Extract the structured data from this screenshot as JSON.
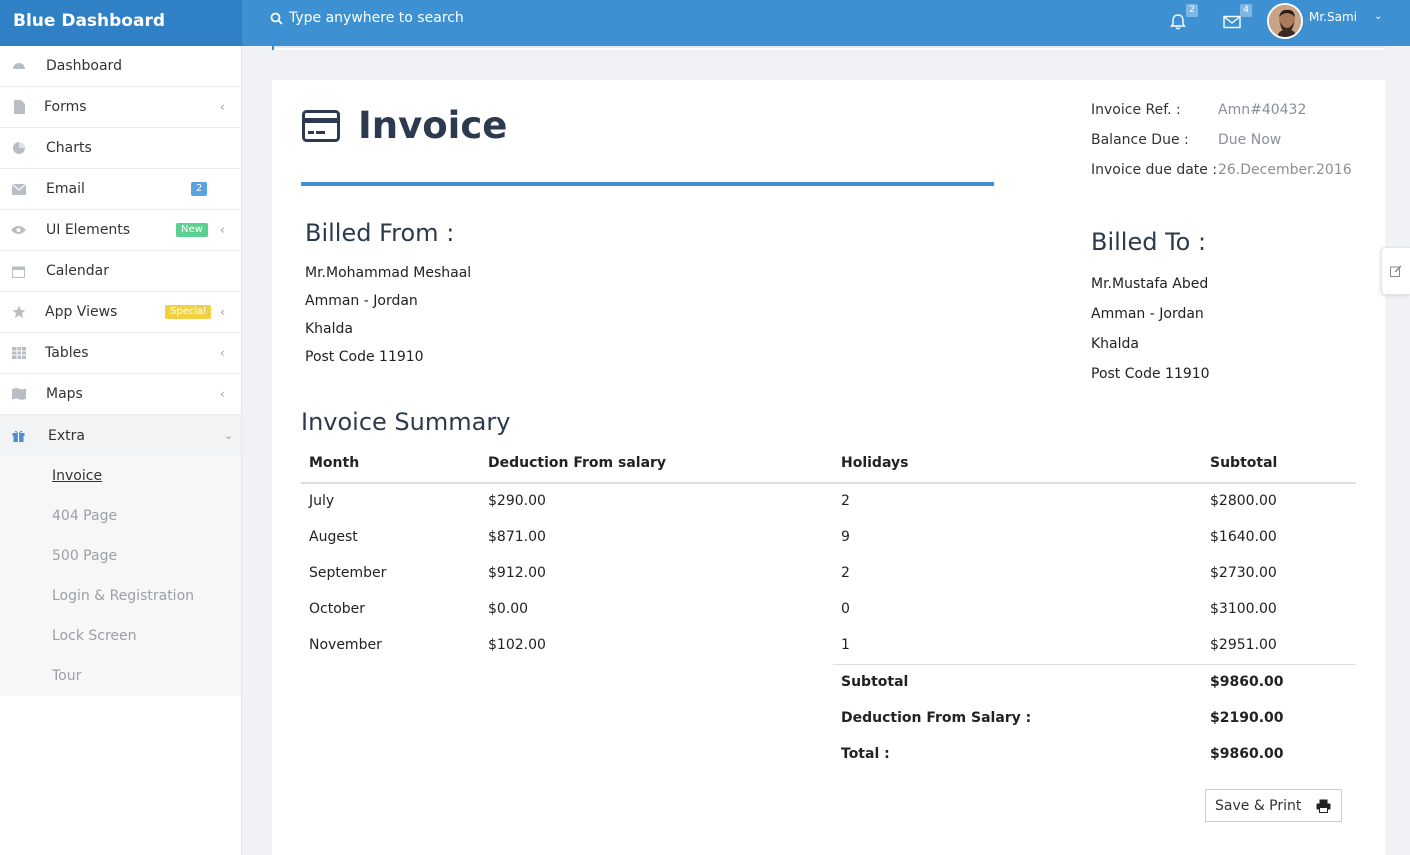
{
  "app": {
    "brand": "Blue Dashboard",
    "search_placeholder": "Type anywhere to search",
    "notifications_count": "2",
    "messages_count": "4",
    "user_name": "Mr.Sami"
  },
  "sidebar": {
    "items": [
      {
        "label": "Dashboard",
        "icon": "dashboard-icon"
      },
      {
        "label": "Forms",
        "icon": "file-icon"
      },
      {
        "label": "Charts",
        "icon": "pie-chart-icon"
      },
      {
        "label": "Email",
        "icon": "envelope-icon",
        "badge": "2"
      },
      {
        "label": "UI Elements",
        "icon": "eye-icon",
        "badge": "New"
      },
      {
        "label": "Calendar",
        "icon": "calendar-icon"
      },
      {
        "label": "App Views",
        "icon": "star-icon",
        "badge": "Special"
      },
      {
        "label": "Tables",
        "icon": "table-icon"
      },
      {
        "label": "Maps",
        "icon": "map-icon"
      },
      {
        "label": "Extra",
        "icon": "gift-icon"
      }
    ],
    "extra_sub": [
      "Invoice",
      "404 Page",
      "500 Page",
      "Login & Registration",
      "Lock Screen",
      "Tour"
    ],
    "colors": {
      "email_badge": "#5ba3dd",
      "new_badge": "#5cd18f",
      "special_badge": "#f1d13f"
    }
  },
  "invoice": {
    "title": "Invoice",
    "meta": [
      {
        "label": "Invoice Ref. :",
        "value": "Amn#40432"
      },
      {
        "label": "Balance Due :",
        "value": "Due Now"
      },
      {
        "label": "Invoice due date :",
        "value": "26.December.2016"
      }
    ],
    "billed_from": {
      "heading": "Billed From :",
      "lines": [
        "Mr.Mohammad Meshaal",
        "Amman - Jordan",
        "Khalda",
        "Post Code 11910"
      ]
    },
    "billed_to": {
      "heading": "Billed To :",
      "lines": [
        "Mr.Mustafa Abed",
        "Amman - Jordan",
        "Khalda",
        "Post Code 11910"
      ]
    },
    "summary_title": "Invoice Summary",
    "columns": [
      "Month",
      "Deduction From salary",
      "Holidays",
      "Subtotal"
    ],
    "rows": [
      [
        "July",
        "$290.00",
        "2",
        "$2800.00"
      ],
      [
        "Augest",
        "$871.00",
        "9",
        "$1640.00"
      ],
      [
        "September",
        "$912.00",
        "2",
        "$2730.00"
      ],
      [
        "October",
        "$0.00",
        "0",
        "$3100.00"
      ],
      [
        "November",
        "$102.00",
        "1",
        "$2951.00"
      ]
    ],
    "totals": [
      {
        "label": "Subtotal",
        "value": "$9860.00"
      },
      {
        "label": "Deduction From Salary :",
        "value": "$2190.00"
      },
      {
        "label": "Total :",
        "value": "$9860.00"
      }
    ],
    "save_label": "Save & Print"
  }
}
